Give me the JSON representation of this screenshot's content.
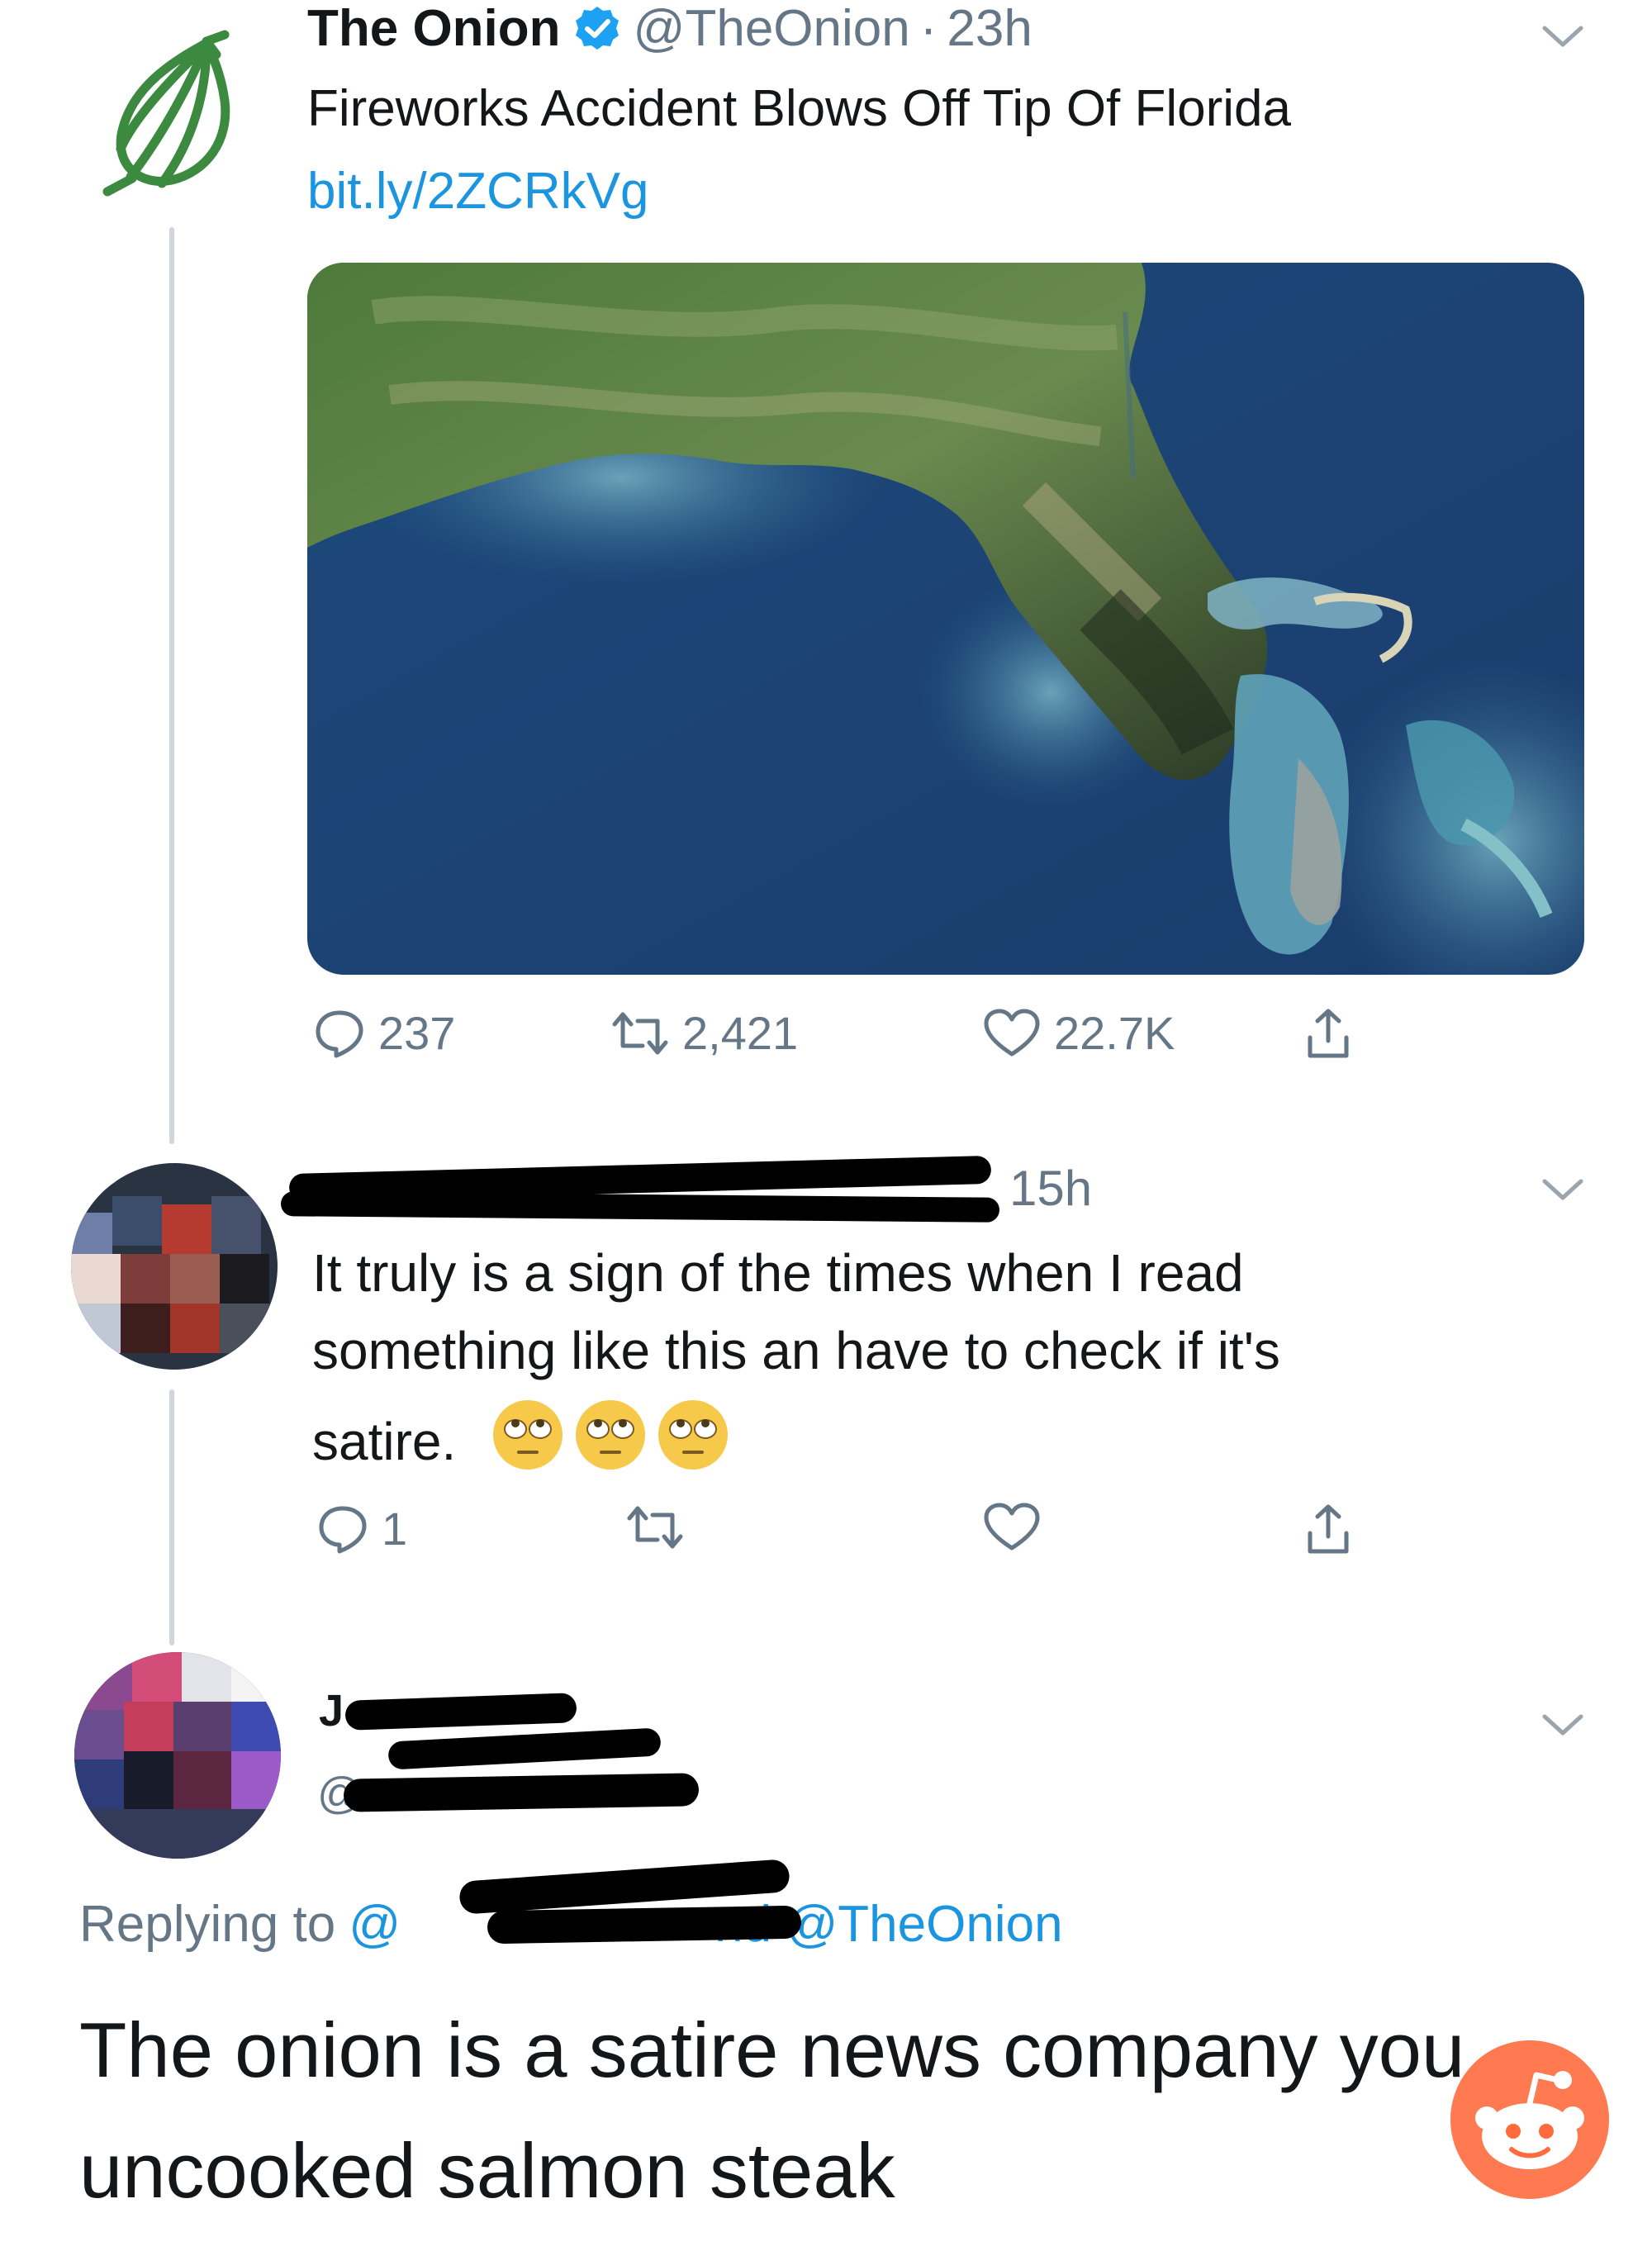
{
  "tweet1": {
    "name": "The Onion",
    "handle": "@TheOnion",
    "time_sep": "·",
    "time": "23h",
    "text": "Fireworks Accident Blows Off Tip Of Florida",
    "link": "bit.ly/2ZCRkVg",
    "image_alt": "Satellite view of Florida peninsula",
    "stats": {
      "replies": "237",
      "retweets": "2,421",
      "likes": "22.7K"
    }
  },
  "tweet2": {
    "time": "15h",
    "text_line1": "It truly is a sign of the times when I read",
    "text_line2": "something like this an have to check if it's",
    "text_line3": "satire.",
    "emojis": [
      "face-with-rolling-eyes",
      "face-with-rolling-eyes",
      "face-with-rolling-eyes"
    ],
    "stats": {
      "replies": "1"
    }
  },
  "tweet3": {
    "name_fragment": "J",
    "handle_fragment": "@",
    "replying_prefix": "Replying to",
    "replying_at": "@",
    "replying_suffix": "nd @TheOnion",
    "text_line1": "The onion is a satire news company you",
    "text_line2": "uncooked salmon steak"
  },
  "colors": {
    "onion_green": "#3b8a3f",
    "verified_blue": "#1da1f2",
    "link_blue": "#1b95e0",
    "grey_text": "#657786",
    "reddit_orange": "#ff6b3d"
  },
  "icons": [
    "onion-logo-icon",
    "verified-badge-icon",
    "chevron-down-icon",
    "reply-icon",
    "retweet-icon",
    "like-icon",
    "share-icon",
    "reddit-snoo-icon"
  ]
}
